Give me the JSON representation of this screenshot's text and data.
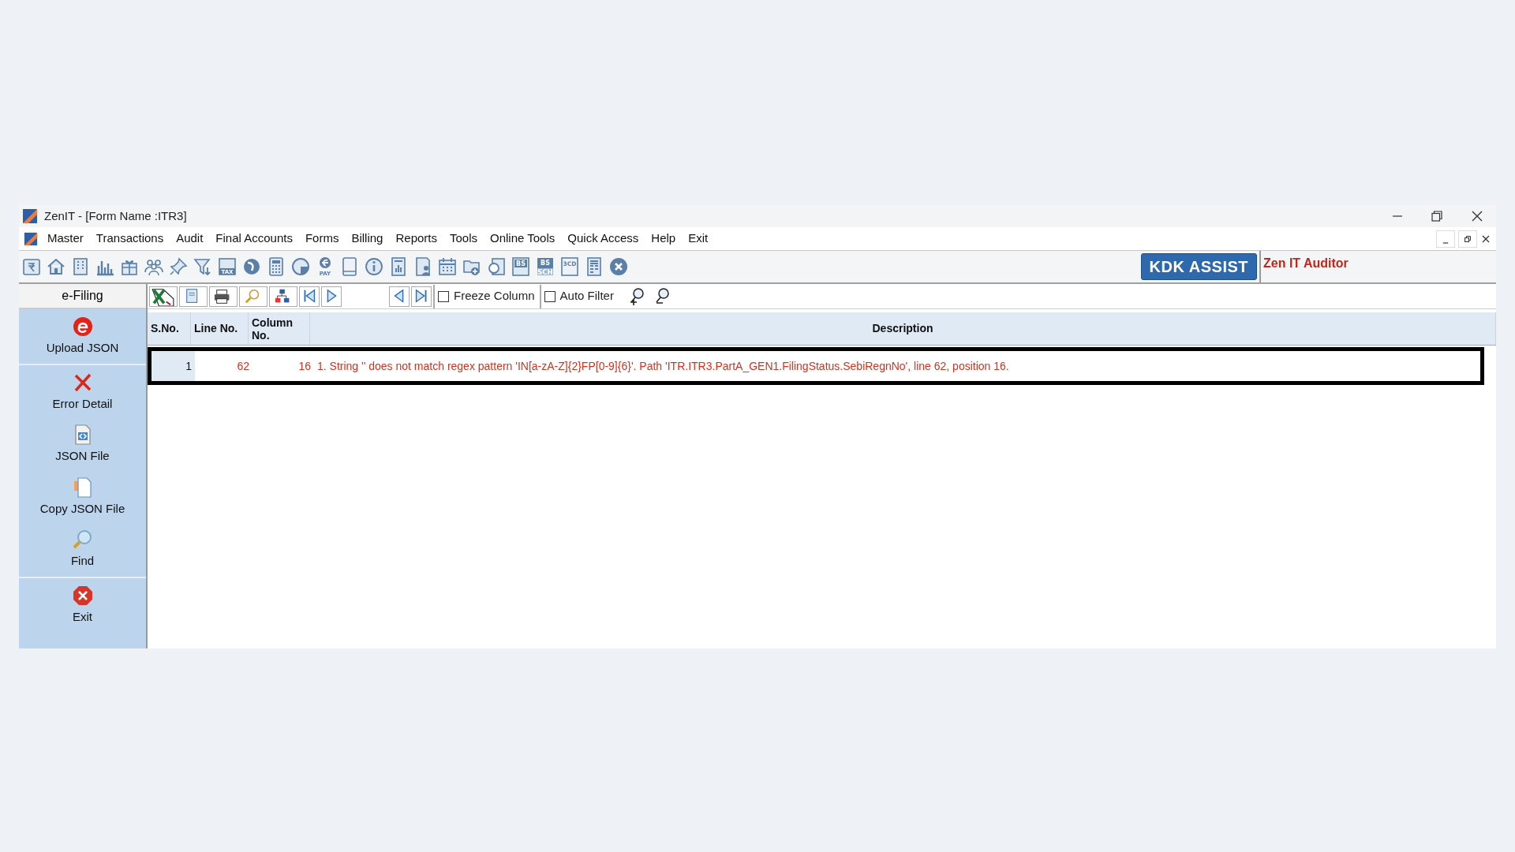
{
  "window": {
    "title": "ZenIT - [Form Name :ITR3]"
  },
  "menu": [
    "Master",
    "Transactions",
    "Audit",
    "Final Accounts",
    "Forms",
    "Billing",
    "Reports",
    "Tools",
    "Online Tools",
    "Quick Access",
    "Help",
    "Exit"
  ],
  "toolbar": [
    {
      "kind": "rupee-book"
    },
    {
      "kind": "home"
    },
    {
      "kind": "building"
    },
    {
      "kind": "bar-chart"
    },
    {
      "kind": "gift"
    },
    {
      "kind": "people"
    },
    {
      "kind": "pin"
    },
    {
      "kind": "filter"
    },
    {
      "kind": "tax",
      "label": "TAX"
    },
    {
      "kind": "disc"
    },
    {
      "kind": "calculator"
    },
    {
      "kind": "pie"
    },
    {
      "kind": "pay",
      "label": "PAY"
    },
    {
      "kind": "tablet"
    },
    {
      "kind": "info"
    },
    {
      "kind": "report"
    },
    {
      "kind": "doc-user"
    },
    {
      "kind": "calendar"
    },
    {
      "kind": "folder-add"
    },
    {
      "kind": "doc-circle"
    },
    {
      "kind": "bs",
      "label": "BS"
    },
    {
      "kind": "bs-sch",
      "label": "BS",
      "sublabel": "SCH"
    },
    {
      "kind": "threecd",
      "label": "3CD"
    },
    {
      "kind": "doc-grid"
    },
    {
      "kind": "close"
    }
  ],
  "assist_button": "KDK ASSIST",
  "product": "Zen IT Auditor",
  "sidebar": {
    "header": "e-Filing",
    "groups": [
      {
        "items": [
          {
            "kind": "upload",
            "label": "Upload JSON"
          }
        ]
      },
      {
        "items": [
          {
            "kind": "error",
            "label": "Error Detail"
          },
          {
            "kind": "json",
            "label": "JSON File"
          },
          {
            "kind": "copy",
            "label": "Copy JSON File"
          },
          {
            "kind": "find",
            "label": "Find"
          }
        ]
      },
      {
        "items": [
          {
            "kind": "exit",
            "label": "Exit"
          }
        ]
      }
    ]
  },
  "grid_toolbar": [
    {
      "kind": "excel"
    },
    {
      "kind": "save"
    },
    {
      "kind": "print"
    },
    {
      "kind": "search"
    },
    {
      "kind": "tree"
    },
    {
      "kind": "first"
    },
    {
      "kind": "next"
    },
    {
      "kind": "gap"
    },
    {
      "kind": "prev"
    },
    {
      "kind": "last"
    },
    {
      "kind": "checkbox",
      "label": "Freeze Column",
      "checked": false
    },
    {
      "kind": "checkbox",
      "label": "Auto Filter",
      "checked": false
    },
    {
      "kind": "zoom-in"
    },
    {
      "kind": "zoom-out"
    }
  ],
  "table": {
    "columns": [
      "S.No.",
      "Line No.",
      "Column No.",
      "Description"
    ],
    "rows": [
      {
        "selected": true,
        "cells": [
          "1",
          "62",
          "16",
          "1. String '' does not match regex pattern 'IN[a-zA-Z]{2}FP[0-9]{6}'. Path 'ITR.ITR3.PartA_GEN1.FilingStatus.SebiRegnNo', line 62, position 16."
        ]
      }
    ]
  }
}
